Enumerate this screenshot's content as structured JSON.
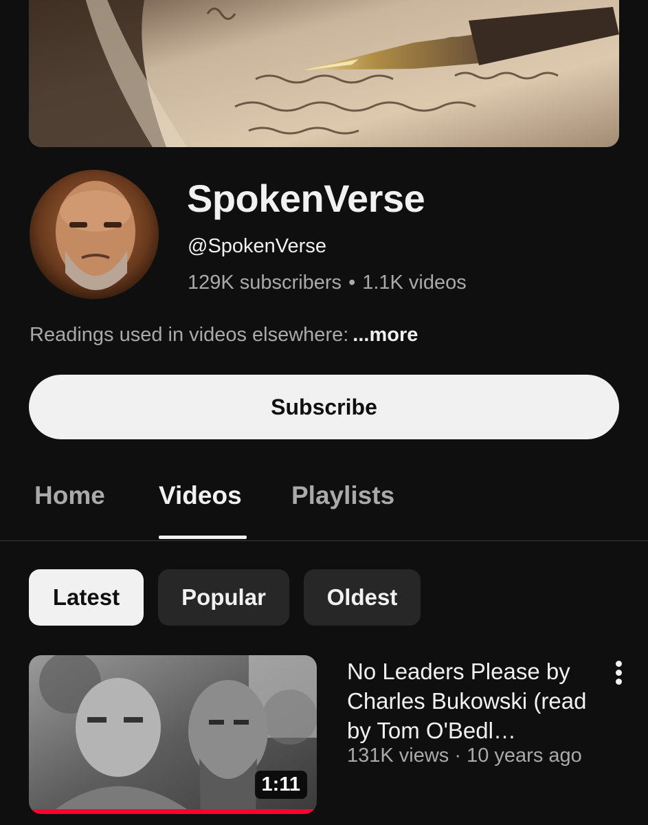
{
  "channel": {
    "name": "SpokenVerse",
    "handle": "@SpokenVerse",
    "subscribers": "129K subscribers",
    "separator": "•",
    "video_count": "1.1K videos",
    "description": "Readings used in videos elsewhere:",
    "more_label": "...more",
    "subscribe_label": "Subscribe"
  },
  "tabs": [
    {
      "label": "Home",
      "active": false
    },
    {
      "label": "Videos",
      "active": true
    },
    {
      "label": "Playlists",
      "active": false
    }
  ],
  "filters": [
    {
      "label": "Latest",
      "selected": true
    },
    {
      "label": "Popular",
      "selected": false
    },
    {
      "label": "Oldest",
      "selected": false
    }
  ],
  "videos": [
    {
      "title": "No Leaders Please by Charles Bukowski (read by Tom O'Bedl…",
      "views": "131K views",
      "meta_separator": "·",
      "age": "10 years ago",
      "duration": "1:11",
      "watched_fraction": 1.0
    }
  ],
  "colors": {
    "background": "#0f0f0f",
    "text_primary": "#f1f1f1",
    "text_secondary": "#aaaaaa",
    "chip_bg": "#272727",
    "progress": "#ff0033"
  },
  "icons": {
    "more_actions": "kebab-vertical-icon"
  }
}
